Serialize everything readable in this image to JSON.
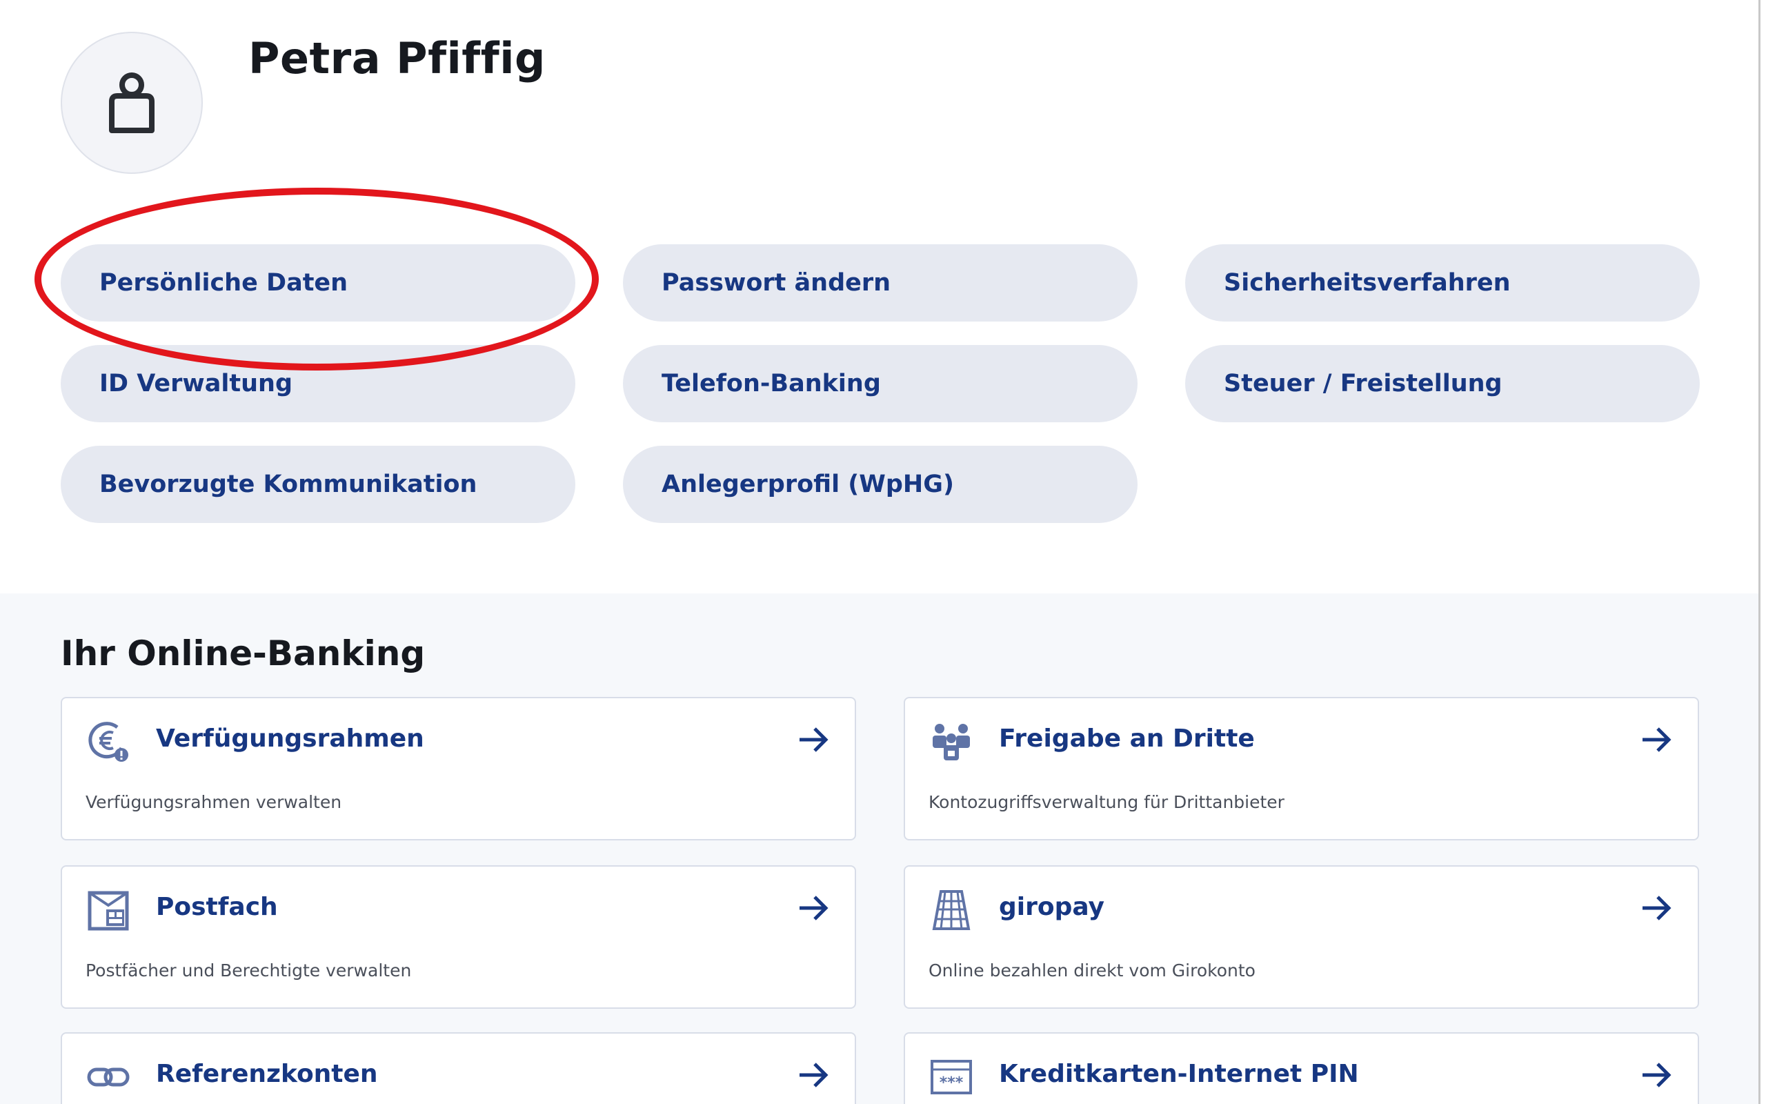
{
  "profile": {
    "name": "Petra Pfiffig",
    "avatar_icon": "user-icon"
  },
  "settings_links": [
    "Persönliche Daten",
    "Passwort ändern",
    "Sicherheitsverfahren",
    "ID Verwaltung",
    "Telefon-Banking",
    "Steuer / Freistellung",
    "Bevorzugte Kommunikation",
    "Anlegerprofil (WpHG)"
  ],
  "banking": {
    "title": "Ihr Online-Banking",
    "cards": [
      {
        "title": "Verfügungsrahmen",
        "description": "Verfügungsrahmen verwalten",
        "icon": "euro-limit-icon"
      },
      {
        "title": "Freigabe an Dritte",
        "description": "Kontozugriffsverwaltung für Drittanbieter",
        "icon": "third-party-access-icon"
      },
      {
        "title": "Postfach",
        "description": "Postfächer und Berechtigte verwalten",
        "icon": "mailbox-icon"
      },
      {
        "title": "giropay",
        "description": "Online bezahlen direkt vom Girokonto",
        "icon": "giropay-icon"
      },
      {
        "title": "Referenzkonten",
        "description": "",
        "icon": "link-icon"
      },
      {
        "title": "Kreditkarten-Internet PIN",
        "description": "",
        "icon": "pin-icon"
      }
    ]
  },
  "colors": {
    "accent": "#173782",
    "pill_background": "#e6e9f1",
    "highlight_annotation": "#e2161c",
    "section_background": "#f6f8fb",
    "icon_color": "#5f73a6"
  }
}
